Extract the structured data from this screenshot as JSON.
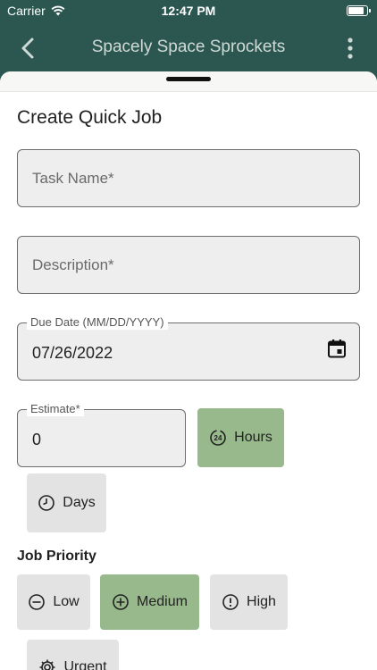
{
  "status": {
    "carrier": "Carrier",
    "time": "12:47 PM",
    "battery_level": 0.85
  },
  "nav": {
    "title": "Spacely Space Sprockets"
  },
  "form": {
    "title": "Create Quick Job",
    "task_name": {
      "placeholder": "Task Name*"
    },
    "description": {
      "placeholder": "Description*"
    },
    "due_date": {
      "label": "Due Date (MM/DD/YYYY)",
      "value": "07/26/2022"
    },
    "estimate": {
      "label": "Estimate*",
      "value": "0"
    },
    "units": [
      {
        "label": "Hours",
        "icon": "clock-24h-icon",
        "selected": true
      },
      {
        "label": "Days",
        "icon": "clock-icon",
        "selected": false
      }
    ],
    "priority_label": "Job Priority",
    "priorities": [
      {
        "label": "Low",
        "icon": "minus-circle-icon",
        "selected": false
      },
      {
        "label": "Medium",
        "icon": "plus-circle-icon",
        "selected": true
      },
      {
        "label": "High",
        "icon": "exclamation-circle-icon",
        "selected": false
      },
      {
        "label": "Urgent",
        "icon": "gear-icon",
        "selected": false
      }
    ]
  },
  "colors": {
    "header": "#2c5750",
    "selected_chip": "#98b98b",
    "chip": "#e3e3e3"
  }
}
